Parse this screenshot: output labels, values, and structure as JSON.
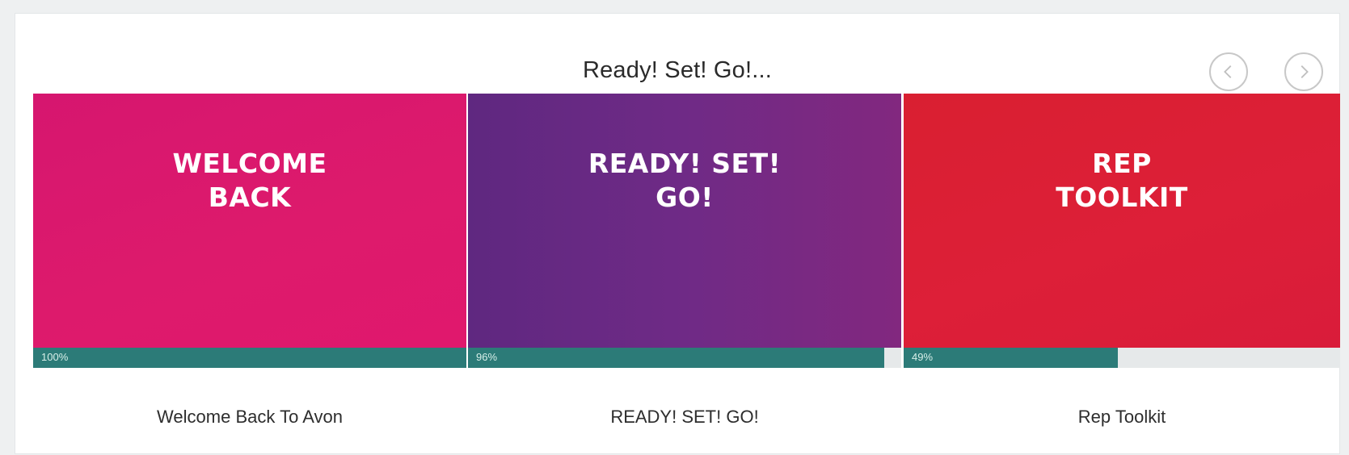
{
  "header": {
    "title": "Ready! Set! Go!..."
  },
  "nav": {
    "prev_icon": "chevron-left-icon",
    "next_icon": "chevron-right-icon"
  },
  "cards": [
    {
      "thumb_text": "WELCOME\nBACK",
      "progress_label": "100%",
      "progress": 1.0,
      "caption": "Welcome Back To Avon",
      "color": "#dd1a6c"
    },
    {
      "thumb_text": "READY! SET!\nGO!",
      "progress_label": "96%",
      "progress": 0.96,
      "caption": "READY! SET! GO!",
      "color": "#6f2a86"
    },
    {
      "thumb_text": "REP\nTOOLKIT",
      "progress_label": "49%",
      "progress": 0.49,
      "caption": "Rep Toolkit",
      "color": "#dd1f38"
    }
  ],
  "colors": {
    "progress_fill": "#2c7b78",
    "progress_track": "#e6e9ea"
  }
}
